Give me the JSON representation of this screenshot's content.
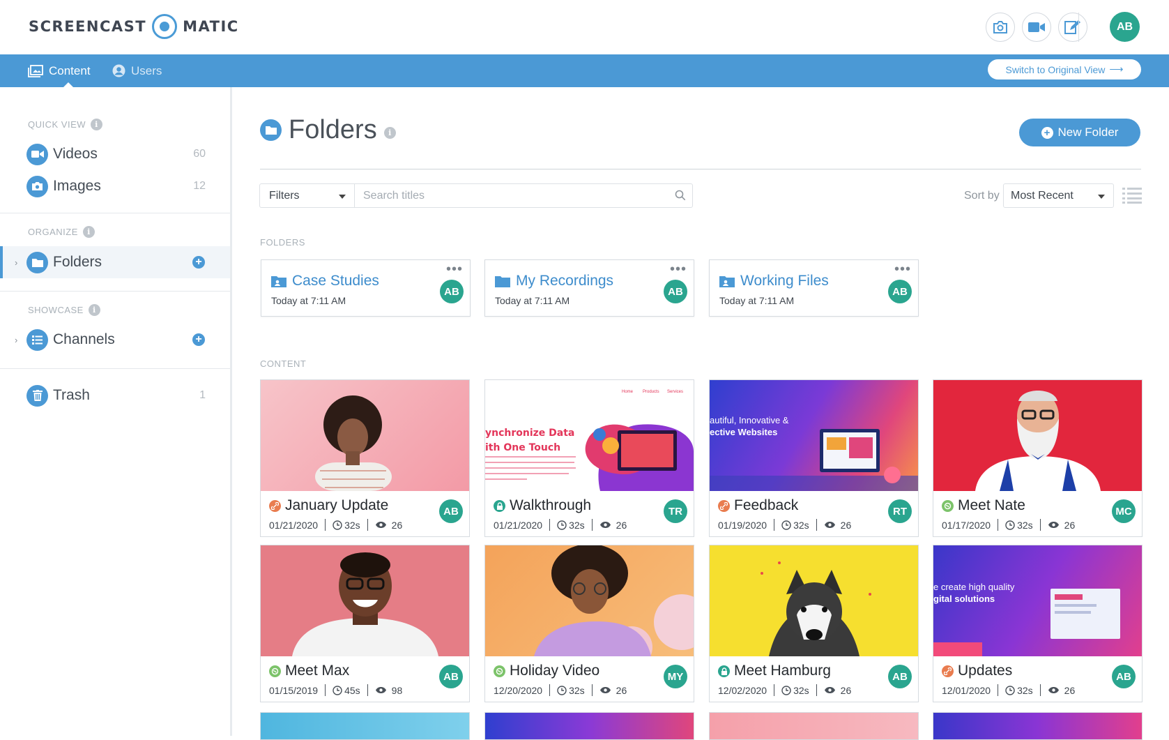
{
  "brand": {
    "left": "SCREENCAST",
    "right": "MATIC"
  },
  "user_initials": "AB",
  "nav": {
    "content": "Content",
    "users": "Users",
    "switch_view": "Switch to Original View"
  },
  "sidebar": {
    "quick_view": "QUICK VIEW",
    "videos": {
      "label": "Videos",
      "count": "60"
    },
    "images": {
      "label": "Images",
      "count": "12"
    },
    "organize": "ORGANIZE",
    "folders": {
      "label": "Folders"
    },
    "showcase": "SHOWCASE",
    "channels": {
      "label": "Channels"
    },
    "trash": {
      "label": "Trash",
      "count": "1"
    }
  },
  "main": {
    "title": "Folders",
    "new_folder": "New Folder",
    "filters": "Filters",
    "search_placeholder": "Search titles",
    "sort_by": "Sort by",
    "sort_value": "Most Recent",
    "folders_label": "FOLDERS",
    "content_label": "CONTENT"
  },
  "folders": [
    {
      "name": "Case Studies",
      "date": "Today at 7:11 AM",
      "owner": "AB",
      "icon": "shared-folder-icon"
    },
    {
      "name": "My Recordings",
      "date": "Today at 7:11 AM",
      "owner": "AB",
      "icon": "folder-icon"
    },
    {
      "name": "Working Files",
      "date": "Today at 7:11 AM",
      "owner": "AB",
      "icon": "shared-folder-icon"
    }
  ],
  "content": [
    {
      "title": "January Update",
      "date": "01/21/2020",
      "duration": "32s",
      "views": "26",
      "owner": "AB",
      "status": "link",
      "thumb": "woman-pink-bg"
    },
    {
      "title": "Walkthrough",
      "date": "01/21/2020",
      "duration": "32s",
      "views": "26",
      "owner": "TR",
      "status": "lock",
      "thumb": "synchronize-data-website"
    },
    {
      "title": "Feedback",
      "date": "01/19/2020",
      "duration": "32s",
      "views": "26",
      "owner": "RT",
      "status": "link",
      "thumb": "innovative-websites"
    },
    {
      "title": "Meet Nate",
      "date": "01/17/2020",
      "duration": "32s",
      "views": "26",
      "owner": "MC",
      "status": "public",
      "thumb": "bearded-man-red-bg"
    },
    {
      "title": "Meet Max",
      "date": "01/15/2019",
      "duration": "45s",
      "views": "98",
      "owner": "AB",
      "status": "public",
      "thumb": "smiling-man-pink-bg"
    },
    {
      "title": "Holiday Video",
      "date": "12/20/2020",
      "duration": "32s",
      "views": "26",
      "owner": "MY",
      "status": "public",
      "thumb": "woman-balloons"
    },
    {
      "title": "Meet Hamburg",
      "date": "12/02/2020",
      "duration": "32s",
      "views": "26",
      "owner": "AB",
      "status": "lock",
      "thumb": "husky-yellow-bg"
    },
    {
      "title": "Updates",
      "date": "12/01/2020",
      "duration": "32s",
      "views": "26",
      "owner": "AB",
      "status": "link",
      "thumb": "high-quality-solutions"
    }
  ],
  "thumb_text": {
    "walkthrough": {
      "line1": "ynchronize Data",
      "line2": "ith One Touch",
      "nav1": "Home",
      "nav2": "Products",
      "nav3": "Services"
    },
    "feedback": {
      "line1": "autiful, Innovative &",
      "line2": "ective Websites"
    },
    "updates": {
      "line1": "e create high quality",
      "line2": "gital solutions"
    }
  },
  "colors": {
    "accent": "#4b99d5",
    "avatar": "#2aa58f",
    "link_status": "#e97c4f",
    "public_status": "#7cc36a"
  }
}
